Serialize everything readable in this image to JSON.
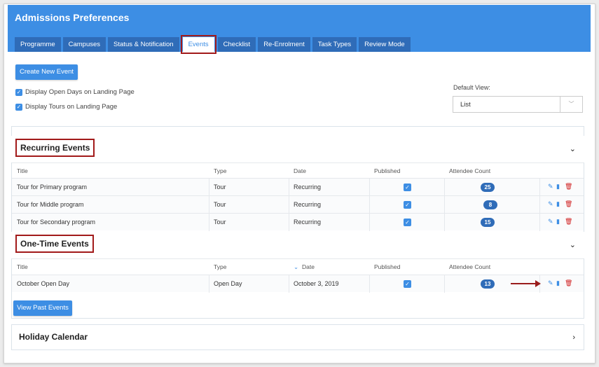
{
  "header": {
    "title": "Admissions Preferences",
    "tabs": [
      "Programme",
      "Campuses",
      "Status & Notification",
      "Events",
      "Checklist",
      "Re-Enrolment",
      "Task Types",
      "Review Mode"
    ],
    "active_tab": "Events"
  },
  "actions": {
    "create_event": "Create New Event",
    "view_past": "View Past Events"
  },
  "options": {
    "open_days": "Display Open Days on Landing Page",
    "tours": "Display Tours on Landing Page"
  },
  "default_view": {
    "label": "Default View:",
    "value": "List"
  },
  "recurring": {
    "title": "Recurring Events",
    "columns": [
      "Title",
      "Type",
      "Date",
      "Published",
      "Attendee Count"
    ],
    "rows": [
      {
        "title": "Tour for Primary program",
        "type": "Tour",
        "date": "Recurring",
        "count": "25"
      },
      {
        "title": "Tour for Middle program",
        "type": "Tour",
        "date": "Recurring",
        "count": "8"
      },
      {
        "title": "Tour for Secondary program",
        "type": "Tour",
        "date": "Recurring",
        "count": "15"
      }
    ]
  },
  "onetime": {
    "title": "One-Time Events",
    "columns": [
      "Title",
      "Type",
      "Date",
      "Published",
      "Attendee Count"
    ],
    "rows": [
      {
        "title": "October Open Day",
        "type": "Open Day",
        "date": "October 3, 2019",
        "count": "13"
      }
    ]
  },
  "holiday": {
    "title": "Holiday Calendar"
  },
  "colors": {
    "accent": "#3d8ee4",
    "tab_dark": "#2f6cb8",
    "highlight": "#a21a1a",
    "delete": "#d02020"
  }
}
